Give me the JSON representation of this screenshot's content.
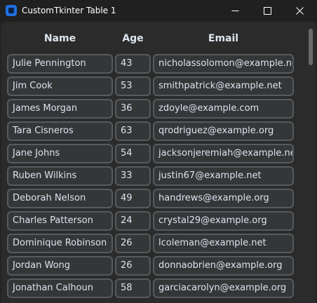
{
  "window": {
    "title": "CustomTkinter Table 1"
  },
  "icons": {
    "app": "app-icon",
    "minimize": "minimize-icon",
    "maximize": "maximize-icon",
    "close": "close-icon"
  },
  "colors": {
    "background": "#242424",
    "frame": "#2b2b2b",
    "entry_bg": "#343638",
    "entry_border": "#565b5e",
    "text": "#dce4ee",
    "app_icon": "#1f6fe0"
  },
  "table": {
    "headers": {
      "name": "Name",
      "age": "Age",
      "email": "Email"
    },
    "rows": [
      {
        "name": "Julie Pennington",
        "age": "43",
        "email": "nicholassolomon@example.net"
      },
      {
        "name": "Jim Cook",
        "age": "53",
        "email": "smithpatrick@example.net"
      },
      {
        "name": "James Morgan",
        "age": "36",
        "email": "zdoyle@example.com"
      },
      {
        "name": "Tara Cisneros",
        "age": "63",
        "email": "qrodriguez@example.org"
      },
      {
        "name": "Jane Johns",
        "age": "54",
        "email": "jacksonjeremiah@example.net"
      },
      {
        "name": "Ruben Wilkins",
        "age": "33",
        "email": "justin67@example.net"
      },
      {
        "name": "Deborah Nelson",
        "age": "49",
        "email": "handrews@example.org"
      },
      {
        "name": "Charles Patterson",
        "age": "24",
        "email": "crystal29@example.org"
      },
      {
        "name": "Dominique Robinson",
        "age": "26",
        "email": "lcoleman@example.net"
      },
      {
        "name": "Jordan Wong",
        "age": "26",
        "email": "donnaobrien@example.org"
      },
      {
        "name": "Jonathan Calhoun",
        "age": "58",
        "email": "garciacarolyn@example.org"
      }
    ]
  }
}
